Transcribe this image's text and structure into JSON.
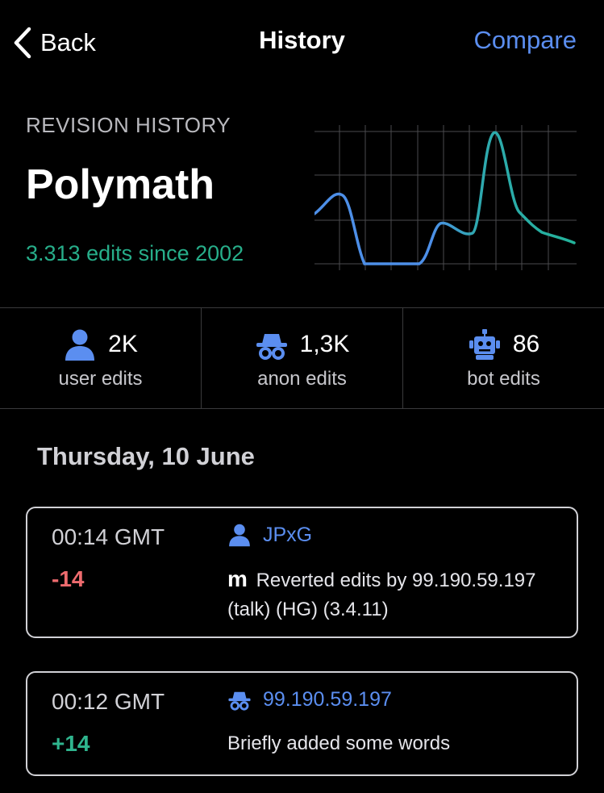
{
  "nav": {
    "back_label": "Back",
    "title": "History",
    "compare_label": "Compare"
  },
  "header": {
    "eyebrow": "REVISION HISTORY",
    "article_title": "Polymath",
    "edits_summary": "3.313 edits since 2002"
  },
  "colors": {
    "accent_blue": "#5b8ef0",
    "accent_green": "#27ae8a",
    "negative_red": "#ee6b6e",
    "sparkline_start": "#4d8fe8",
    "sparkline_end": "#23b39a"
  },
  "stats": [
    {
      "icon": "user-icon",
      "count": "2K",
      "label": "user edits"
    },
    {
      "icon": "anon-icon",
      "count": "1,3K",
      "label": "anon edits"
    },
    {
      "icon": "bot-icon",
      "count": "86",
      "label": "bot edits"
    }
  ],
  "date_heading": "Thursday, 10 June",
  "revisions": [
    {
      "time": "00:14 GMT",
      "delta": "-14",
      "user_icon": "user-icon",
      "user": "JPxG",
      "minor_badge": "m",
      "summary": "Reverted edits by 99.190.59.197 (talk) (HG) (3.4.11)"
    },
    {
      "time": "00:12 GMT",
      "delta": "+14",
      "user_icon": "anon-icon",
      "user": "99.190.59.197",
      "summary": "Briefly added some words"
    }
  ]
}
